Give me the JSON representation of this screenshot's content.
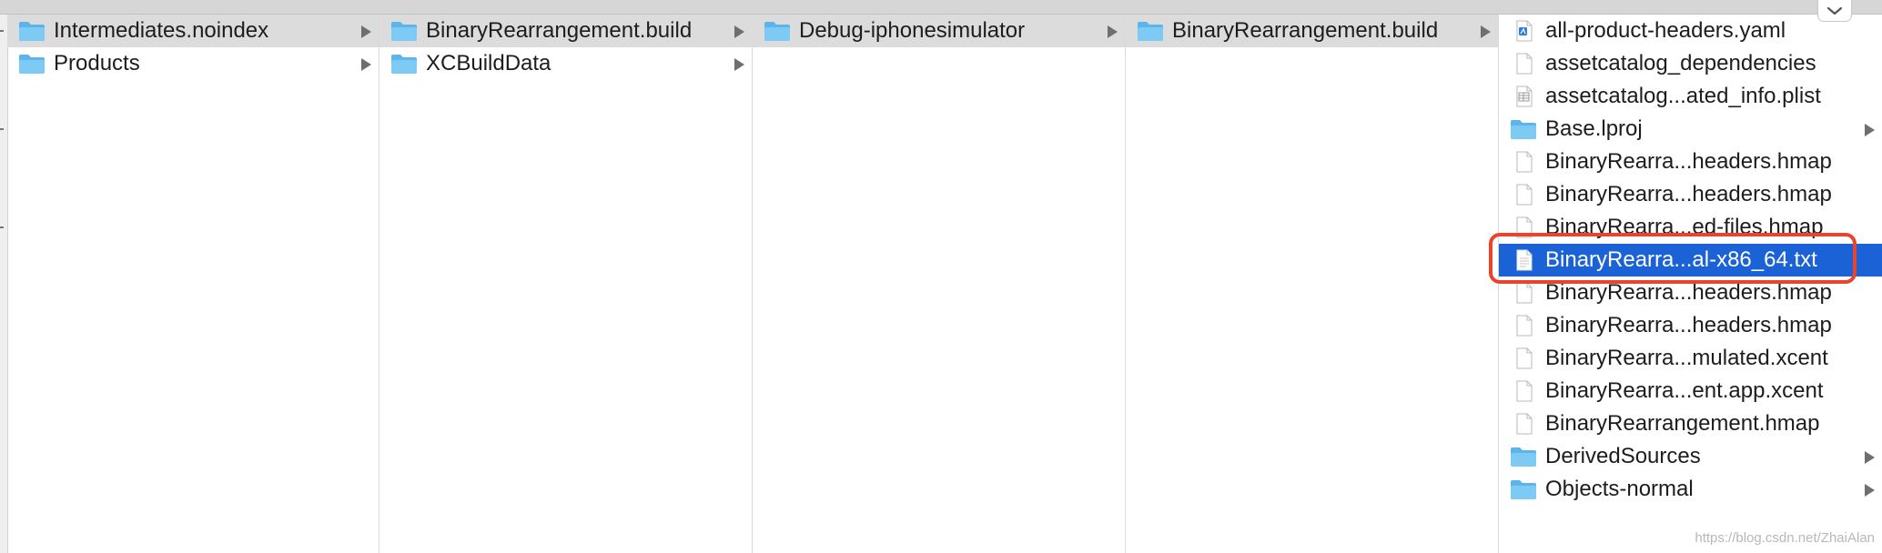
{
  "columns": [
    {
      "items": [
        {
          "label": "Intermediates.noindex",
          "icon": "folder-icon",
          "has_children": true,
          "state": "path"
        },
        {
          "label": "Products",
          "icon": "folder-icon",
          "has_children": true,
          "state": "normal"
        }
      ]
    },
    {
      "items": [
        {
          "label": "BinaryRearrangement.build",
          "icon": "folder-icon",
          "has_children": true,
          "state": "path"
        },
        {
          "label": "XCBuildData",
          "icon": "folder-icon",
          "has_children": true,
          "state": "normal"
        }
      ]
    },
    {
      "items": [
        {
          "label": "Debug-iphonesimulator",
          "icon": "folder-icon",
          "has_children": true,
          "state": "path"
        }
      ]
    },
    {
      "items": [
        {
          "label": "BinaryRearrangement.build",
          "icon": "folder-icon",
          "has_children": true,
          "state": "path"
        }
      ]
    },
    {
      "items": [
        {
          "label": "all-product-headers.yaml",
          "icon": "yaml-file-icon",
          "has_children": false,
          "state": "normal"
        },
        {
          "label": "assetcatalog_dependencies",
          "icon": "document-icon",
          "has_children": false,
          "state": "normal"
        },
        {
          "label": "assetcatalog...ated_info.plist",
          "icon": "plist-file-icon",
          "has_children": false,
          "state": "normal"
        },
        {
          "label": "Base.lproj",
          "icon": "folder-icon",
          "has_children": true,
          "state": "normal"
        },
        {
          "label": "BinaryRearra...headers.hmap",
          "icon": "document-icon",
          "has_children": false,
          "state": "normal"
        },
        {
          "label": "BinaryRearra...headers.hmap",
          "icon": "document-icon",
          "has_children": false,
          "state": "normal"
        },
        {
          "label": "BinaryRearra...ed-files.hmap",
          "icon": "document-icon",
          "has_children": false,
          "state": "normal"
        },
        {
          "label": "BinaryRearra...al-x86_64.txt",
          "icon": "text-file-icon",
          "has_children": false,
          "state": "selected"
        },
        {
          "label": "BinaryRearra...headers.hmap",
          "icon": "document-icon",
          "has_children": false,
          "state": "normal"
        },
        {
          "label": "BinaryRearra...headers.hmap",
          "icon": "document-icon",
          "has_children": false,
          "state": "normal"
        },
        {
          "label": "BinaryRearra...mulated.xcent",
          "icon": "document-icon",
          "has_children": false,
          "state": "normal"
        },
        {
          "label": "BinaryRearra...ent.app.xcent",
          "icon": "document-icon",
          "has_children": false,
          "state": "normal"
        },
        {
          "label": "BinaryRearrangement.hmap",
          "icon": "document-icon",
          "has_children": false,
          "state": "normal"
        },
        {
          "label": "DerivedSources",
          "icon": "folder-icon",
          "has_children": true,
          "state": "normal"
        },
        {
          "label": "Objects-normal",
          "icon": "folder-icon",
          "has_children": true,
          "state": "normal"
        }
      ]
    }
  ],
  "watermark": "https://blog.csdn.net/ZhaiAlan",
  "colors": {
    "selection": "#1b62d6",
    "path_highlight": "#dcdcdc",
    "annotation_box": "#e8452c",
    "folder": "#6cc0f0"
  }
}
